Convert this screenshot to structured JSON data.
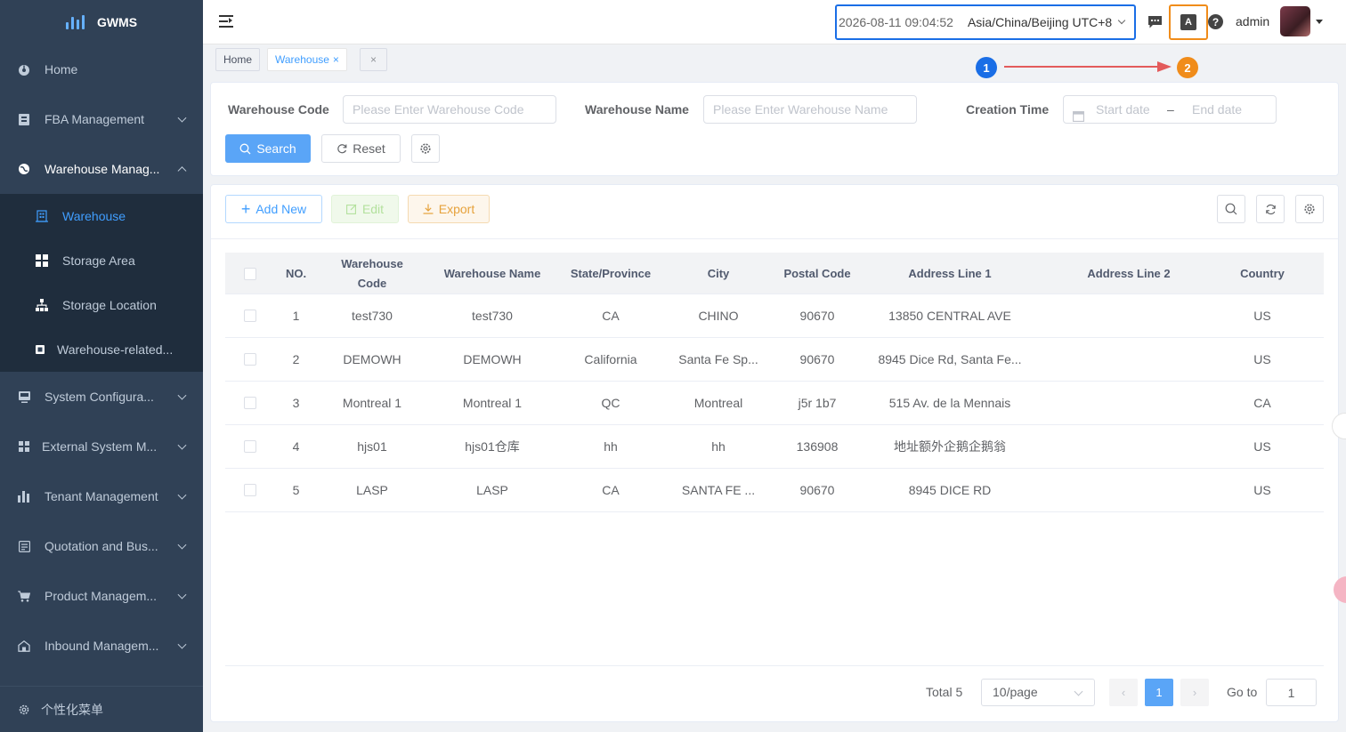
{
  "app": {
    "name": "GWMS"
  },
  "sidebar": {
    "items": [
      {
        "label": "Home",
        "icon": "dashboard-icon"
      },
      {
        "label": "FBA Management",
        "icon": "fba-icon"
      },
      {
        "label": "Warehouse Manag...",
        "icon": "globe-icon"
      },
      {
        "label": "System Configura...",
        "icon": "system-icon"
      },
      {
        "label": "External System M...",
        "icon": "grid-icon"
      },
      {
        "label": "Tenant Management",
        "icon": "chart-icon"
      },
      {
        "label": "Quotation and Bus...",
        "icon": "quotation-icon"
      },
      {
        "label": "Product Managem...",
        "icon": "cart-icon"
      },
      {
        "label": "Inbound Managem...",
        "icon": "inbound-icon"
      }
    ],
    "subitems": [
      {
        "label": "Warehouse",
        "icon": "building-icon"
      },
      {
        "label": "Storage Area",
        "icon": "tiles-icon"
      },
      {
        "label": "Storage Location",
        "icon": "tree-icon"
      },
      {
        "label": "Warehouse-related...",
        "icon": "doc-icon"
      }
    ],
    "footer_label": "个性化菜单"
  },
  "header": {
    "datetime": "2026-08-11 09:04:52",
    "timezone": "Asia/China/Beijing UTC+8",
    "lang_glyph": "A",
    "help_glyph": "?",
    "user": "admin"
  },
  "tags": {
    "home": "Home",
    "current": "Warehouse",
    "close_glyph": "×"
  },
  "annotations": {
    "one": "1",
    "two": "2",
    "color_one": "#1a6ee6",
    "color_two": "#f08c1a"
  },
  "search": {
    "code_label": "Warehouse Code",
    "code_placeholder": "Please Enter Warehouse Code",
    "name_label": "Warehouse Name",
    "name_placeholder": "Please Enter Warehouse Name",
    "time_label": "Creation Time",
    "start_placeholder": "Start date",
    "range_sep": "–",
    "end_placeholder": "End date",
    "search_btn": "Search",
    "reset_btn": "Reset"
  },
  "toolbar": {
    "add": "Add New",
    "edit": "Edit",
    "export": "Export"
  },
  "table": {
    "headers": [
      "NO.",
      "Warehouse Code",
      "Warehouse Name",
      "State/Province",
      "City",
      "Postal Code",
      "Address Line 1",
      "Address Line 2",
      "Country"
    ],
    "rows": [
      [
        "1",
        "test730",
        "test730",
        "CA",
        "CHINO",
        "90670",
        "13850 CENTRAL AVE",
        "",
        "US"
      ],
      [
        "2",
        "DEMOWH",
        "DEMOWH",
        "California",
        "Santa Fe Sp...",
        "90670",
        "8945 Dice Rd, Santa Fe...",
        "",
        "US"
      ],
      [
        "3",
        "Montreal 1",
        "Montreal 1",
        "QC",
        "Montreal",
        "j5r 1b7",
        "515 Av. de la Mennais",
        "",
        "CA"
      ],
      [
        "4",
        "hjs01",
        "hjs01仓库",
        "hh",
        "hh",
        "136908",
        "地址额外企鹅企鹅翁",
        "",
        "US"
      ],
      [
        "5",
        "LASP",
        "LASP",
        "CA",
        "SANTA FE ...",
        "90670",
        "8945 DICE RD",
        "",
        "US"
      ]
    ]
  },
  "pagination": {
    "total": "Total 5",
    "page_size": "10/page",
    "prev": "‹",
    "current": "1",
    "next": "›",
    "goto_label": "Go to",
    "goto_value": "1"
  }
}
